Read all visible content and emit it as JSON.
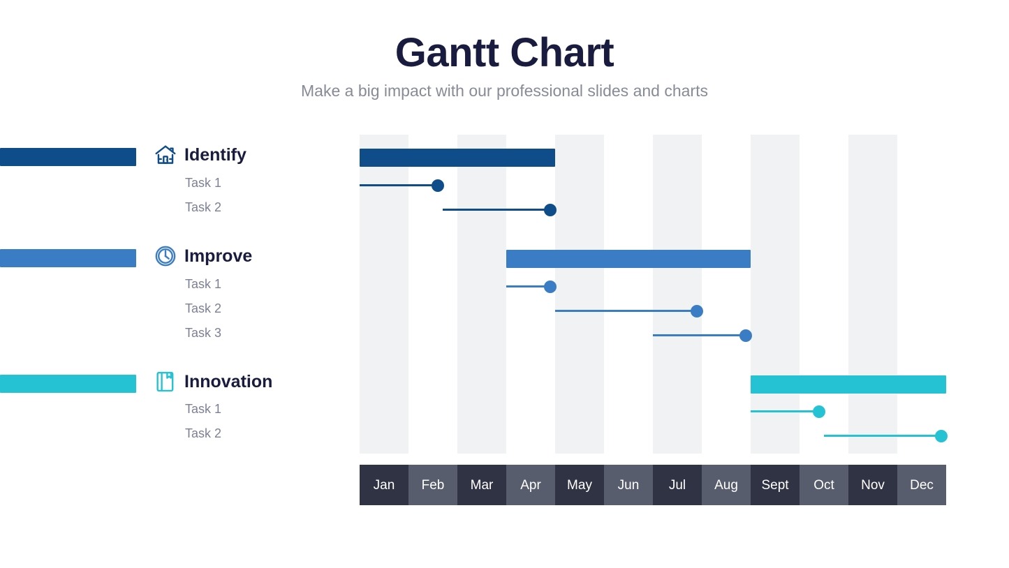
{
  "header": {
    "title": "Gantt Chart",
    "subtitle": "Make a big impact with our professional slides and charts"
  },
  "colors": {
    "identify": "#0f4d8a",
    "improve": "#3b7dc4",
    "innovation": "#25c2d3",
    "band": "#f0f2f4",
    "month_dark": "#2f3343",
    "month_light": "#585d6e",
    "title": "#191b3f",
    "subtitle": "#868b96",
    "task_label": "#7b8095"
  },
  "legend": {
    "groups": [
      {
        "name": "Identify",
        "icon": "house-icon",
        "color": "#0f4d8a",
        "tasks": [
          "Task 1",
          "Task 2"
        ]
      },
      {
        "name": "Improve",
        "icon": "clock-icon",
        "color": "#3b7dc4",
        "tasks": [
          "Task 1",
          "Task 2",
          "Task 3"
        ]
      },
      {
        "name": "Innovation",
        "icon": "book-icon",
        "color": "#25c2d3",
        "tasks": [
          "Task 1",
          "Task 2"
        ]
      }
    ]
  },
  "chart_data": {
    "type": "bar",
    "title": "Gantt Chart",
    "subtitle": "Make a big impact with our professional slides and charts",
    "xlabel": "",
    "ylabel": "",
    "categories": [
      "Jan",
      "Feb",
      "Mar",
      "Apr",
      "May",
      "Jun",
      "Jul",
      "Aug",
      "Sept",
      "Oct",
      "Nov",
      "Dec"
    ],
    "xlim": [
      0,
      12
    ],
    "grid": "alternating vertical bands on Jan, Mar, May, Jul, Sept, Nov",
    "legend_position": "left",
    "series": [
      {
        "name": "Identify",
        "color": "#0f4d8a",
        "type": "phase",
        "start_month": 1,
        "end_month": 5,
        "tasks": [
          {
            "name": "Task 1",
            "start_month": 1,
            "end_month": 2.6,
            "milestone_month": 2.6
          },
          {
            "name": "Task 2",
            "start_month": 2.7,
            "end_month": 4.9,
            "milestone_month": 4.9
          }
        ]
      },
      {
        "name": "Improve",
        "color": "#3b7dc4",
        "type": "phase",
        "start_month": 4,
        "end_month": 9,
        "tasks": [
          {
            "name": "Task 1",
            "start_month": 4,
            "end_month": 4.9,
            "milestone_month": 4.9
          },
          {
            "name": "Task 2",
            "start_month": 5.0,
            "end_month": 7.9,
            "milestone_month": 7.9
          },
          {
            "name": "Task 3",
            "start_month": 7.0,
            "end_month": 8.9,
            "milestone_month": 8.9
          }
        ]
      },
      {
        "name": "Innovation",
        "color": "#25c2d3",
        "type": "phase",
        "start_month": 9,
        "end_month": 13,
        "tasks": [
          {
            "name": "Task 1",
            "start_month": 9,
            "end_month": 10.4,
            "milestone_month": 10.4
          },
          {
            "name": "Task 2",
            "start_month": 10.5,
            "end_month": 12.9,
            "milestone_month": 12.9
          }
        ]
      }
    ]
  },
  "axis": {
    "months": [
      {
        "label": "Jan",
        "shade": "dark"
      },
      {
        "label": "Feb",
        "shade": "light"
      },
      {
        "label": "Mar",
        "shade": "dark"
      },
      {
        "label": "Apr",
        "shade": "light"
      },
      {
        "label": "May",
        "shade": "dark"
      },
      {
        "label": "Jun",
        "shade": "light"
      },
      {
        "label": "Jul",
        "shade": "dark"
      },
      {
        "label": "Aug",
        "shade": "light"
      },
      {
        "label": "Sept",
        "shade": "dark"
      },
      {
        "label": "Oct",
        "shade": "light"
      },
      {
        "label": "Nov",
        "shade": "dark"
      },
      {
        "label": "Dec",
        "shade": "light"
      }
    ]
  }
}
